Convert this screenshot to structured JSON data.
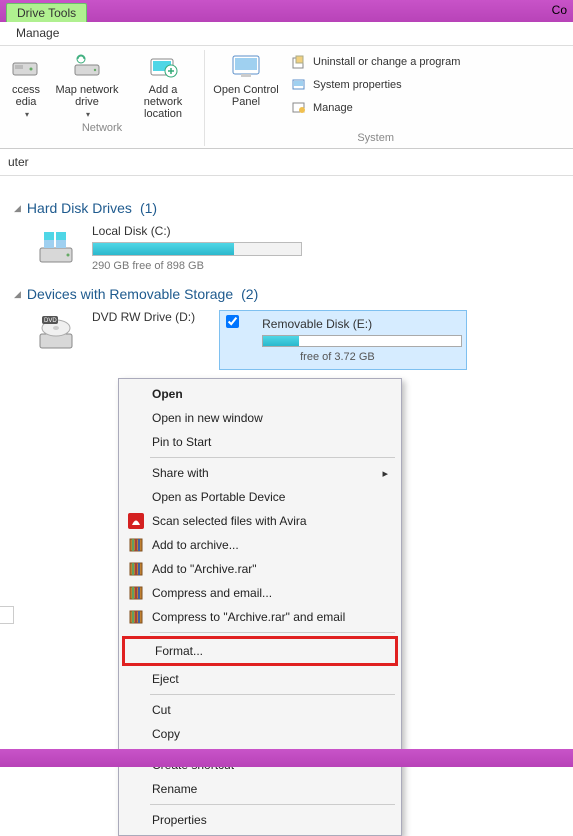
{
  "window": {
    "drive_tools_tab": "Drive Tools",
    "manage_tab": "Manage",
    "title_fragment": "Co"
  },
  "ribbon": {
    "network": {
      "access_media": "ccess\nedia",
      "map_drive": "Map network\ndrive",
      "add_location": "Add a network\nlocation",
      "label": "Network"
    },
    "system": {
      "open_cp": "Open Control\nPanel",
      "uninstall": "Uninstall or change a program",
      "properties": "System properties",
      "manage": "Manage",
      "label": "System"
    }
  },
  "address": {
    "path": "uter"
  },
  "sections": {
    "hdd": {
      "title": "Hard Disk Drives",
      "count": "(1)"
    },
    "removable": {
      "title": "Devices with Removable Storage",
      "count": "(2)"
    }
  },
  "local_disk": {
    "label": "Local Disk (C:)",
    "free": "290 GB free of 898 GB",
    "fill_pct": 68
  },
  "dvd": {
    "label": "DVD RW Drive (D:)"
  },
  "removable_disk": {
    "label": "Removable Disk (E:)",
    "sub": "free of 3.72 GB",
    "fill_pct": 18,
    "checked": true
  },
  "menu": {
    "open": "Open",
    "open_new": "Open in new window",
    "pin": "Pin to Start",
    "share": "Share with",
    "portable": "Open as Portable Device",
    "avira": "Scan selected files with Avira",
    "archive_add": "Add to archive...",
    "archive_to": "Add to \"Archive.rar\"",
    "compress_email": "Compress and email...",
    "compress_to_email": "Compress to \"Archive.rar\" and email",
    "format": "Format...",
    "eject": "Eject",
    "cut": "Cut",
    "copy": "Copy",
    "shortcut": "Create shortcut",
    "rename": "Rename",
    "properties": "Properties"
  }
}
